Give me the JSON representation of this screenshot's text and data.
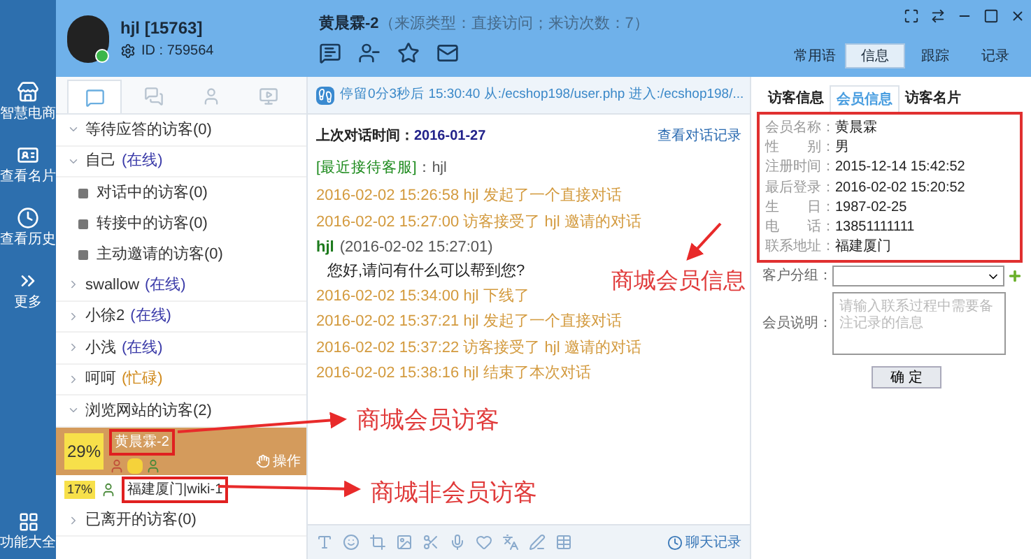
{
  "rail": {
    "items": [
      {
        "label": "智慧电商",
        "kind": "store"
      },
      {
        "label": "查看名片",
        "kind": "card"
      },
      {
        "label": "查看历史",
        "kind": "history"
      },
      {
        "label": "更多",
        "kind": "more"
      }
    ],
    "bottom": "功能大全"
  },
  "agent": {
    "name": "hjl [15763]",
    "id": "ID : 759564"
  },
  "conversation": {
    "visitor": "黄晨霖-2",
    "source": "（来源类型：直接访问；来访次数：7）"
  },
  "right_tabs": [
    {
      "label": "常用语",
      "selected": false
    },
    {
      "label": "信息",
      "selected": true
    },
    {
      "label": "跟踪",
      "selected": false
    },
    {
      "label": "记录",
      "selected": false
    }
  ],
  "left_tabs": [
    {
      "kind": "chat",
      "selected": true
    },
    {
      "kind": "group",
      "selected": false
    },
    {
      "kind": "user",
      "selected": false
    },
    {
      "kind": "video",
      "selected": false
    }
  ],
  "tree": [
    {
      "label": "等待应答的访客(0)",
      "expanded": true
    },
    {
      "label": "自己",
      "status": "(在线)",
      "color": "#3a3aa8",
      "expanded": true,
      "children": [
        {
          "label": "对话中的访客(0)"
        },
        {
          "label": "转接中的访客(0)"
        },
        {
          "label": "主动邀请的访客(0)"
        }
      ]
    },
    {
      "label": "swallow",
      "status": "(在线)",
      "color": "#3a3aa8",
      "expanded": false
    },
    {
      "label": "小徐2",
      "status": "(在线)",
      "color": "#3a3aa8",
      "expanded": false
    },
    {
      "label": "小浅",
      "status": "(在线)",
      "color": "#3a3aa8",
      "expanded": false
    },
    {
      "label": "呵呵",
      "status": "(忙碌)",
      "color": "#d08a1c",
      "expanded": false
    },
    {
      "label": "浏览网站的访客(2)",
      "expanded": true,
      "visitors": [
        {
          "percent": "29%",
          "name": "黄晨霖-2",
          "member": true,
          "selected": true,
          "action": "操作"
        },
        {
          "percent": "17%",
          "name": "福建厦门|wiki-1",
          "member": false,
          "selected": false
        }
      ]
    },
    {
      "label": "已离开的访客(0)",
      "expanded": false
    }
  ],
  "info_bar": {
    "text": "停留0分3秒后 15:30:40 从:/ecshop198/user.php  进入:/ecshop198/..."
  },
  "chat": {
    "last_time_label": "上次对话时间：",
    "last_time": "2016-01-27",
    "history_link": "查看对话记录",
    "recent_label": "[最近接待客服]",
    "recent_value": "：hjl",
    "lines": [
      {
        "kind": "event",
        "text": "2016-02-02 15:26:58 hjl 发起了一个直接对话"
      },
      {
        "kind": "event",
        "text": "2016-02-02 15:27:00 访客接受了 hjl 邀请的对话"
      },
      {
        "kind": "message",
        "sender": "hjl",
        "time": "(2016-02-02 15:27:01)",
        "text": "您好,请问有什么可以帮到您?"
      },
      {
        "kind": "event",
        "text": "2016-02-02 15:34:00 hjl 下线了"
      },
      {
        "kind": "event",
        "text": "2016-02-02 15:37:21 hjl 发起了一个直接对话"
      },
      {
        "kind": "event",
        "text": "2016-02-02 15:37:22 访客接受了 hjl 邀请的对话"
      },
      {
        "kind": "event",
        "text": "2016-02-02 15:38:16 hjl 结束了本次对话"
      }
    ]
  },
  "toolbar": {
    "history": "聊天记录"
  },
  "info_tabs": [
    {
      "label": "访客信息",
      "selected": false
    },
    {
      "label": "会员信息",
      "selected": true
    },
    {
      "label": "访客名片",
      "selected": false
    }
  ],
  "member_fields": [
    {
      "label": "会员名称：",
      "value": "黄晨霖"
    },
    {
      "label": "性　　别：",
      "value": "男"
    },
    {
      "label": "注册时间：",
      "value": "2015-12-14 15:42:52"
    },
    {
      "label": "最后登录：",
      "value": "2016-02-02 15:20:52"
    },
    {
      "label": "生　　日：",
      "value": "1987-02-25"
    },
    {
      "label": "电　　话：",
      "value": "13851111111"
    },
    {
      "label": "联系地址：",
      "value": "福建厦门"
    }
  ],
  "group_field": {
    "label": "客户分组："
  },
  "note_field": {
    "label": "会员说明：",
    "placeholder": "请输入联系过程中需要备注记录的信息"
  },
  "confirm": "确 定",
  "annotations": [
    {
      "text": "商城会员信息"
    },
    {
      "text": "商城会员访客"
    },
    {
      "text": "商城非会员访客"
    }
  ]
}
